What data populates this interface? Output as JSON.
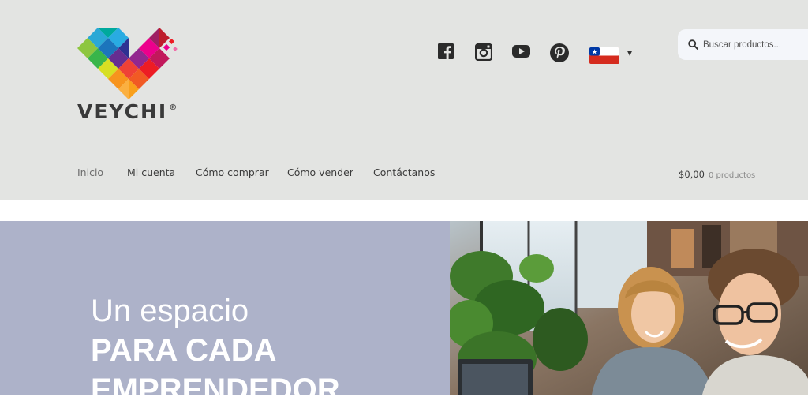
{
  "brand": {
    "name": "VEYCHI",
    "registered_mark": "®"
  },
  "social": [
    "facebook-icon",
    "instagram-icon",
    "youtube-icon",
    "pinterest-icon"
  ],
  "language_selector": {
    "flag": "chile-flag-icon",
    "caret": "▾"
  },
  "search": {
    "placeholder": "Buscar productos..."
  },
  "nav": {
    "items": [
      {
        "label": "Inicio",
        "active": true
      },
      {
        "label": "Mi cuenta"
      },
      {
        "label": "Cómo comprar"
      },
      {
        "label": "Cómo vender"
      },
      {
        "label": "Contáctanos"
      }
    ]
  },
  "cart": {
    "amount": "$0,00",
    "count": "0 productos"
  },
  "hero": {
    "line1": "Un espacio",
    "line2": "PARA CADA",
    "line3": "EMPRENDEDOR"
  },
  "colors": {
    "header_bg": "#e3e4e2",
    "hero_panel": "#adb2c9",
    "search_bg": "#f4f6fa"
  }
}
